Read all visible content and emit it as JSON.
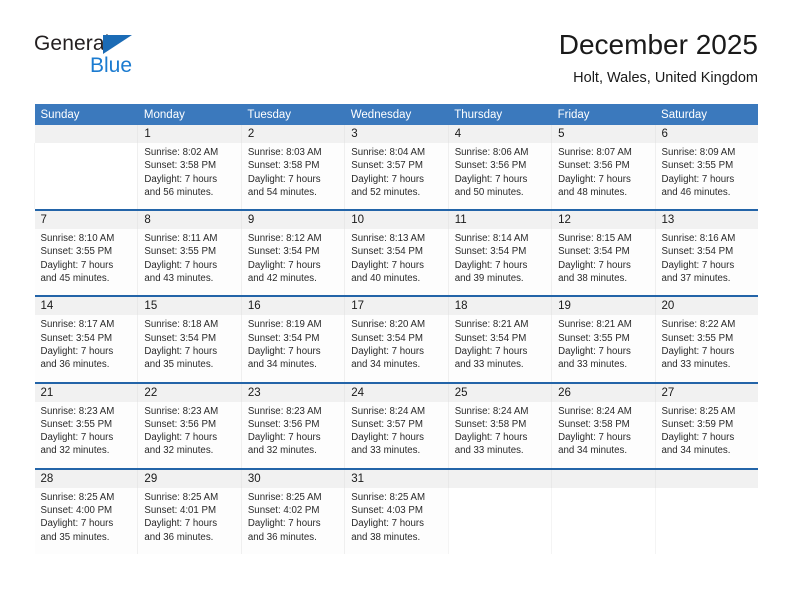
{
  "brand": {
    "name_part1": "General",
    "name_part2": "Blue",
    "triangle_color": "#1b6bb5",
    "blue_color": "#1b7bd0"
  },
  "header": {
    "title": "December 2025",
    "location": "Holt, Wales, United Kingdom"
  },
  "theme": {
    "header_bar_color": "#3b79bd",
    "week_separator_color": "#2364a8",
    "day_number_band_color": "#f1f1f1"
  },
  "weekday_headers": [
    "Sunday",
    "Monday",
    "Tuesday",
    "Wednesday",
    "Thursday",
    "Friday",
    "Saturday"
  ],
  "weeks": [
    {
      "days": [
        {
          "num": "",
          "sunrise": "",
          "sunset": "",
          "daylight_line1": "",
          "daylight_line2": "",
          "blank": true
        },
        {
          "num": "1",
          "sunrise": "Sunrise: 8:02 AM",
          "sunset": "Sunset: 3:58 PM",
          "daylight_line1": "Daylight: 7 hours",
          "daylight_line2": "and 56 minutes.",
          "blank": false
        },
        {
          "num": "2",
          "sunrise": "Sunrise: 8:03 AM",
          "sunset": "Sunset: 3:58 PM",
          "daylight_line1": "Daylight: 7 hours",
          "daylight_line2": "and 54 minutes.",
          "blank": false
        },
        {
          "num": "3",
          "sunrise": "Sunrise: 8:04 AM",
          "sunset": "Sunset: 3:57 PM",
          "daylight_line1": "Daylight: 7 hours",
          "daylight_line2": "and 52 minutes.",
          "blank": false
        },
        {
          "num": "4",
          "sunrise": "Sunrise: 8:06 AM",
          "sunset": "Sunset: 3:56 PM",
          "daylight_line1": "Daylight: 7 hours",
          "daylight_line2": "and 50 minutes.",
          "blank": false
        },
        {
          "num": "5",
          "sunrise": "Sunrise: 8:07 AM",
          "sunset": "Sunset: 3:56 PM",
          "daylight_line1": "Daylight: 7 hours",
          "daylight_line2": "and 48 minutes.",
          "blank": false
        },
        {
          "num": "6",
          "sunrise": "Sunrise: 8:09 AM",
          "sunset": "Sunset: 3:55 PM",
          "daylight_line1": "Daylight: 7 hours",
          "daylight_line2": "and 46 minutes.",
          "blank": false
        }
      ]
    },
    {
      "days": [
        {
          "num": "7",
          "sunrise": "Sunrise: 8:10 AM",
          "sunset": "Sunset: 3:55 PM",
          "daylight_line1": "Daylight: 7 hours",
          "daylight_line2": "and 45 minutes.",
          "blank": false
        },
        {
          "num": "8",
          "sunrise": "Sunrise: 8:11 AM",
          "sunset": "Sunset: 3:55 PM",
          "daylight_line1": "Daylight: 7 hours",
          "daylight_line2": "and 43 minutes.",
          "blank": false
        },
        {
          "num": "9",
          "sunrise": "Sunrise: 8:12 AM",
          "sunset": "Sunset: 3:54 PM",
          "daylight_line1": "Daylight: 7 hours",
          "daylight_line2": "and 42 minutes.",
          "blank": false
        },
        {
          "num": "10",
          "sunrise": "Sunrise: 8:13 AM",
          "sunset": "Sunset: 3:54 PM",
          "daylight_line1": "Daylight: 7 hours",
          "daylight_line2": "and 40 minutes.",
          "blank": false
        },
        {
          "num": "11",
          "sunrise": "Sunrise: 8:14 AM",
          "sunset": "Sunset: 3:54 PM",
          "daylight_line1": "Daylight: 7 hours",
          "daylight_line2": "and 39 minutes.",
          "blank": false
        },
        {
          "num": "12",
          "sunrise": "Sunrise: 8:15 AM",
          "sunset": "Sunset: 3:54 PM",
          "daylight_line1": "Daylight: 7 hours",
          "daylight_line2": "and 38 minutes.",
          "blank": false
        },
        {
          "num": "13",
          "sunrise": "Sunrise: 8:16 AM",
          "sunset": "Sunset: 3:54 PM",
          "daylight_line1": "Daylight: 7 hours",
          "daylight_line2": "and 37 minutes.",
          "blank": false
        }
      ]
    },
    {
      "days": [
        {
          "num": "14",
          "sunrise": "Sunrise: 8:17 AM",
          "sunset": "Sunset: 3:54 PM",
          "daylight_line1": "Daylight: 7 hours",
          "daylight_line2": "and 36 minutes.",
          "blank": false
        },
        {
          "num": "15",
          "sunrise": "Sunrise: 8:18 AM",
          "sunset": "Sunset: 3:54 PM",
          "daylight_line1": "Daylight: 7 hours",
          "daylight_line2": "and 35 minutes.",
          "blank": false
        },
        {
          "num": "16",
          "sunrise": "Sunrise: 8:19 AM",
          "sunset": "Sunset: 3:54 PM",
          "daylight_line1": "Daylight: 7 hours",
          "daylight_line2": "and 34 minutes.",
          "blank": false
        },
        {
          "num": "17",
          "sunrise": "Sunrise: 8:20 AM",
          "sunset": "Sunset: 3:54 PM",
          "daylight_line1": "Daylight: 7 hours",
          "daylight_line2": "and 34 minutes.",
          "blank": false
        },
        {
          "num": "18",
          "sunrise": "Sunrise: 8:21 AM",
          "sunset": "Sunset: 3:54 PM",
          "daylight_line1": "Daylight: 7 hours",
          "daylight_line2": "and 33 minutes.",
          "blank": false
        },
        {
          "num": "19",
          "sunrise": "Sunrise: 8:21 AM",
          "sunset": "Sunset: 3:55 PM",
          "daylight_line1": "Daylight: 7 hours",
          "daylight_line2": "and 33 minutes.",
          "blank": false
        },
        {
          "num": "20",
          "sunrise": "Sunrise: 8:22 AM",
          "sunset": "Sunset: 3:55 PM",
          "daylight_line1": "Daylight: 7 hours",
          "daylight_line2": "and 33 minutes.",
          "blank": false
        }
      ]
    },
    {
      "days": [
        {
          "num": "21",
          "sunrise": "Sunrise: 8:23 AM",
          "sunset": "Sunset: 3:55 PM",
          "daylight_line1": "Daylight: 7 hours",
          "daylight_line2": "and 32 minutes.",
          "blank": false
        },
        {
          "num": "22",
          "sunrise": "Sunrise: 8:23 AM",
          "sunset": "Sunset: 3:56 PM",
          "daylight_line1": "Daylight: 7 hours",
          "daylight_line2": "and 32 minutes.",
          "blank": false
        },
        {
          "num": "23",
          "sunrise": "Sunrise: 8:23 AM",
          "sunset": "Sunset: 3:56 PM",
          "daylight_line1": "Daylight: 7 hours",
          "daylight_line2": "and 32 minutes.",
          "blank": false
        },
        {
          "num": "24",
          "sunrise": "Sunrise: 8:24 AM",
          "sunset": "Sunset: 3:57 PM",
          "daylight_line1": "Daylight: 7 hours",
          "daylight_line2": "and 33 minutes.",
          "blank": false
        },
        {
          "num": "25",
          "sunrise": "Sunrise: 8:24 AM",
          "sunset": "Sunset: 3:58 PM",
          "daylight_line1": "Daylight: 7 hours",
          "daylight_line2": "and 33 minutes.",
          "blank": false
        },
        {
          "num": "26",
          "sunrise": "Sunrise: 8:24 AM",
          "sunset": "Sunset: 3:58 PM",
          "daylight_line1": "Daylight: 7 hours",
          "daylight_line2": "and 34 minutes.",
          "blank": false
        },
        {
          "num": "27",
          "sunrise": "Sunrise: 8:25 AM",
          "sunset": "Sunset: 3:59 PM",
          "daylight_line1": "Daylight: 7 hours",
          "daylight_line2": "and 34 minutes.",
          "blank": false
        }
      ]
    },
    {
      "days": [
        {
          "num": "28",
          "sunrise": "Sunrise: 8:25 AM",
          "sunset": "Sunset: 4:00 PM",
          "daylight_line1": "Daylight: 7 hours",
          "daylight_line2": "and 35 minutes.",
          "blank": false
        },
        {
          "num": "29",
          "sunrise": "Sunrise: 8:25 AM",
          "sunset": "Sunset: 4:01 PM",
          "daylight_line1": "Daylight: 7 hours",
          "daylight_line2": "and 36 minutes.",
          "blank": false
        },
        {
          "num": "30",
          "sunrise": "Sunrise: 8:25 AM",
          "sunset": "Sunset: 4:02 PM",
          "daylight_line1": "Daylight: 7 hours",
          "daylight_line2": "and 36 minutes.",
          "blank": false
        },
        {
          "num": "31",
          "sunrise": "Sunrise: 8:25 AM",
          "sunset": "Sunset: 4:03 PM",
          "daylight_line1": "Daylight: 7 hours",
          "daylight_line2": "and 38 minutes.",
          "blank": false
        },
        {
          "num": "",
          "sunrise": "",
          "sunset": "",
          "daylight_line1": "",
          "daylight_line2": "",
          "blank": true
        },
        {
          "num": "",
          "sunrise": "",
          "sunset": "",
          "daylight_line1": "",
          "daylight_line2": "",
          "blank": true
        },
        {
          "num": "",
          "sunrise": "",
          "sunset": "",
          "daylight_line1": "",
          "daylight_line2": "",
          "blank": true
        }
      ]
    }
  ]
}
